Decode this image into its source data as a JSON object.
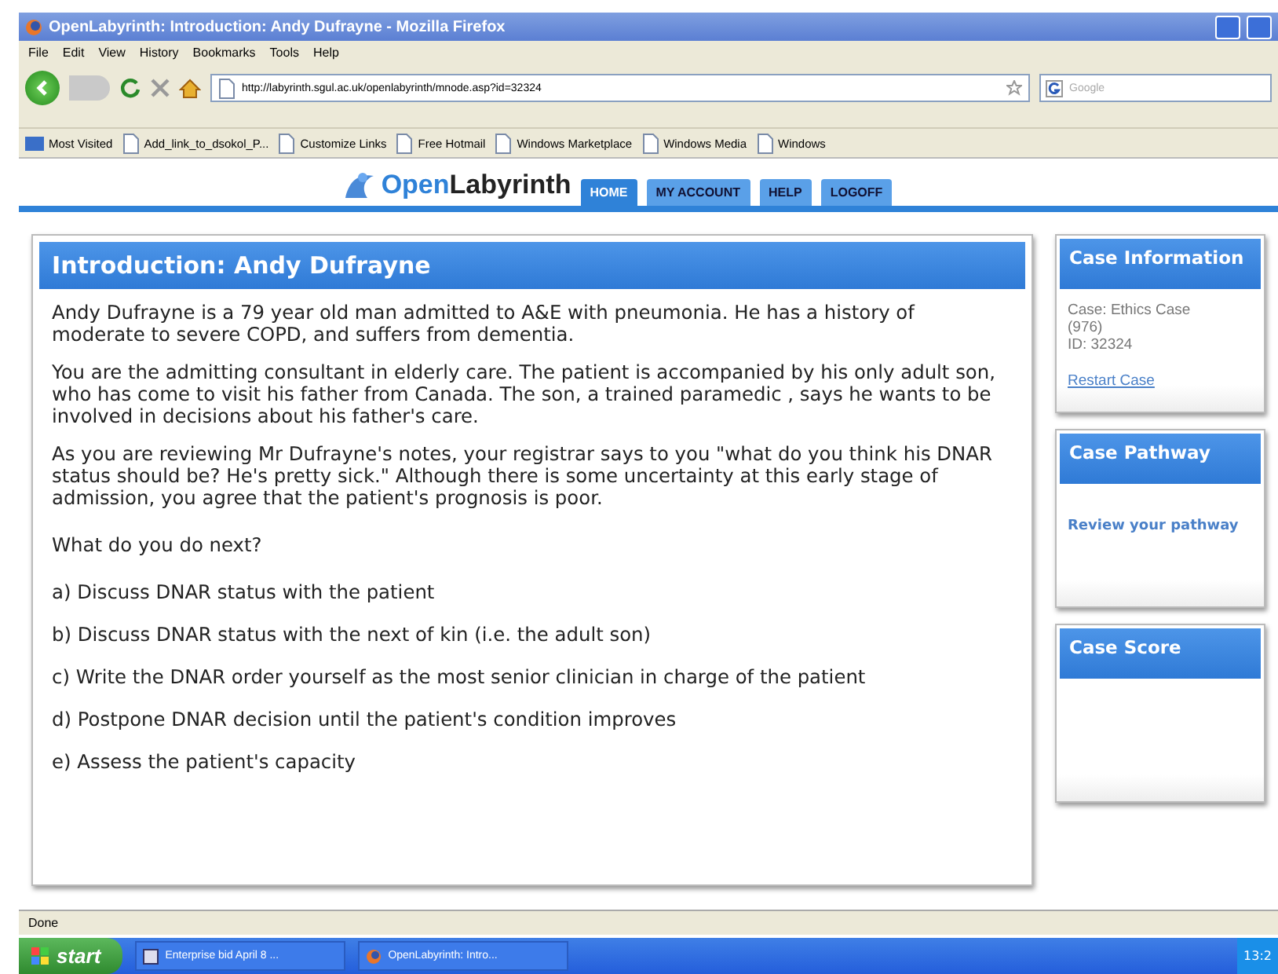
{
  "window": {
    "title": "OpenLabyrinth: Introduction: Andy Dufrayne - Mozilla Firefox"
  },
  "menu": [
    "File",
    "Edit",
    "View",
    "History",
    "Bookmarks",
    "Tools",
    "Help"
  ],
  "address_bar": {
    "url": "http://labyrinth.sgul.ac.uk/openlabyrinth/mnode.asp?id=32324"
  },
  "search": {
    "placeholder": "Google"
  },
  "bookmarks": [
    "Most Visited",
    "Add_link_to_dsokol_P...",
    "Customize Links",
    "Free Hotmail",
    "Windows Marketplace",
    "Windows Media",
    "Windows"
  ],
  "site": {
    "logo_first": "Open",
    "logo_second": "Labyrinth",
    "tabs": [
      {
        "label": "HOME",
        "selected": true
      },
      {
        "label": "MY ACCOUNT",
        "selected": false
      },
      {
        "label": "HELP",
        "selected": false
      },
      {
        "label": "LOGOFF",
        "selected": false
      }
    ]
  },
  "main": {
    "title": "Introduction: Andy Dufrayne",
    "paragraphs": [
      "Andy Dufrayne is a 79 year old man admitted to A&E with pneumonia.  He has a history of moderate to severe COPD, and suffers from dementia.",
      "You are the admitting consultant in elderly care.  The patient is accompanied by his only adult son, who has come to visit his father from Canada. The son, a trained paramedic , says he wants to be involved in decisions about his father's care.",
      "As you are reviewing Mr Dufrayne's notes, your registrar says to you \"what do you think his DNAR status should be?  He's pretty sick.\"  Although there is some uncertainty at this early stage of admission, you agree that the patient's prognosis is poor."
    ],
    "question": "What do you do next?",
    "options": [
      "a) Discuss DNAR status with the patient",
      "b) Discuss DNAR status with the next of kin (i.e. the adult son)",
      "c) Write the DNAR order yourself as the most senior clinician in charge of the patient",
      "d) Postpone DNAR decision until the patient's condition improves",
      "e) Assess the patient's capacity"
    ]
  },
  "sidebar": [
    {
      "title": "Case Information",
      "lines": [
        "Case: Ethics Case",
        "(976)",
        "ID: 32324"
      ],
      "link": "Restart Case",
      "kind": "plain"
    },
    {
      "title": "Case Pathway",
      "link": "Review your pathway",
      "kind": "bold"
    },
    {
      "title": "Case Score"
    }
  ],
  "status_bar": "Done",
  "taskbar": {
    "start": "start",
    "tasks": [
      "Enterprise bid April 8 ...",
      "OpenLabyrinth: Intro..."
    ],
    "clock": "13:2"
  }
}
